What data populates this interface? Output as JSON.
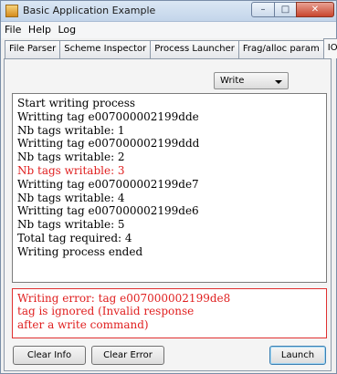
{
  "window": {
    "title": "Basic Application Example",
    "minimize_glyph": "–",
    "maximize_glyph": "□",
    "close_glyph": "✕"
  },
  "menu": [
    "File",
    "Help",
    "Log"
  ],
  "tabs": [
    "File Parser",
    "Scheme Inspector",
    "Process Launcher",
    "Frag/alloc param",
    "IO"
  ],
  "active_tab": "IO",
  "mode_select": {
    "value": "Write"
  },
  "info_log": [
    {
      "text": "Start writing process",
      "error": false
    },
    {
      "text": "Writting tag e007000002199dde",
      "error": false
    },
    {
      "text": "Nb tags writable: 1",
      "error": false
    },
    {
      "text": "Writting tag e007000002199ddd",
      "error": false
    },
    {
      "text": "Nb tags writable: 2",
      "error": false
    },
    {
      "text": "Nb tags writable: 3",
      "error": true
    },
    {
      "text": "Writting tag e007000002199de7",
      "error": false
    },
    {
      "text": "Nb tags writable: 4",
      "error": false
    },
    {
      "text": "Writting tag e007000002199de6",
      "error": false
    },
    {
      "text": "Nb tags writable: 5",
      "error": false
    },
    {
      "text": "Total tag required: 4",
      "error": false
    },
    {
      "text": "Writing process ended",
      "error": false
    }
  ],
  "error_log": "Writing error: tag e007000002199de8\ntag is ignored (Invalid response\nafter a write command)",
  "buttons": {
    "clear_info": "Clear Info",
    "clear_error": "Clear Error",
    "launch": "Launch"
  },
  "colors": {
    "error_text": "#e02020",
    "error_border": "#e03030"
  }
}
